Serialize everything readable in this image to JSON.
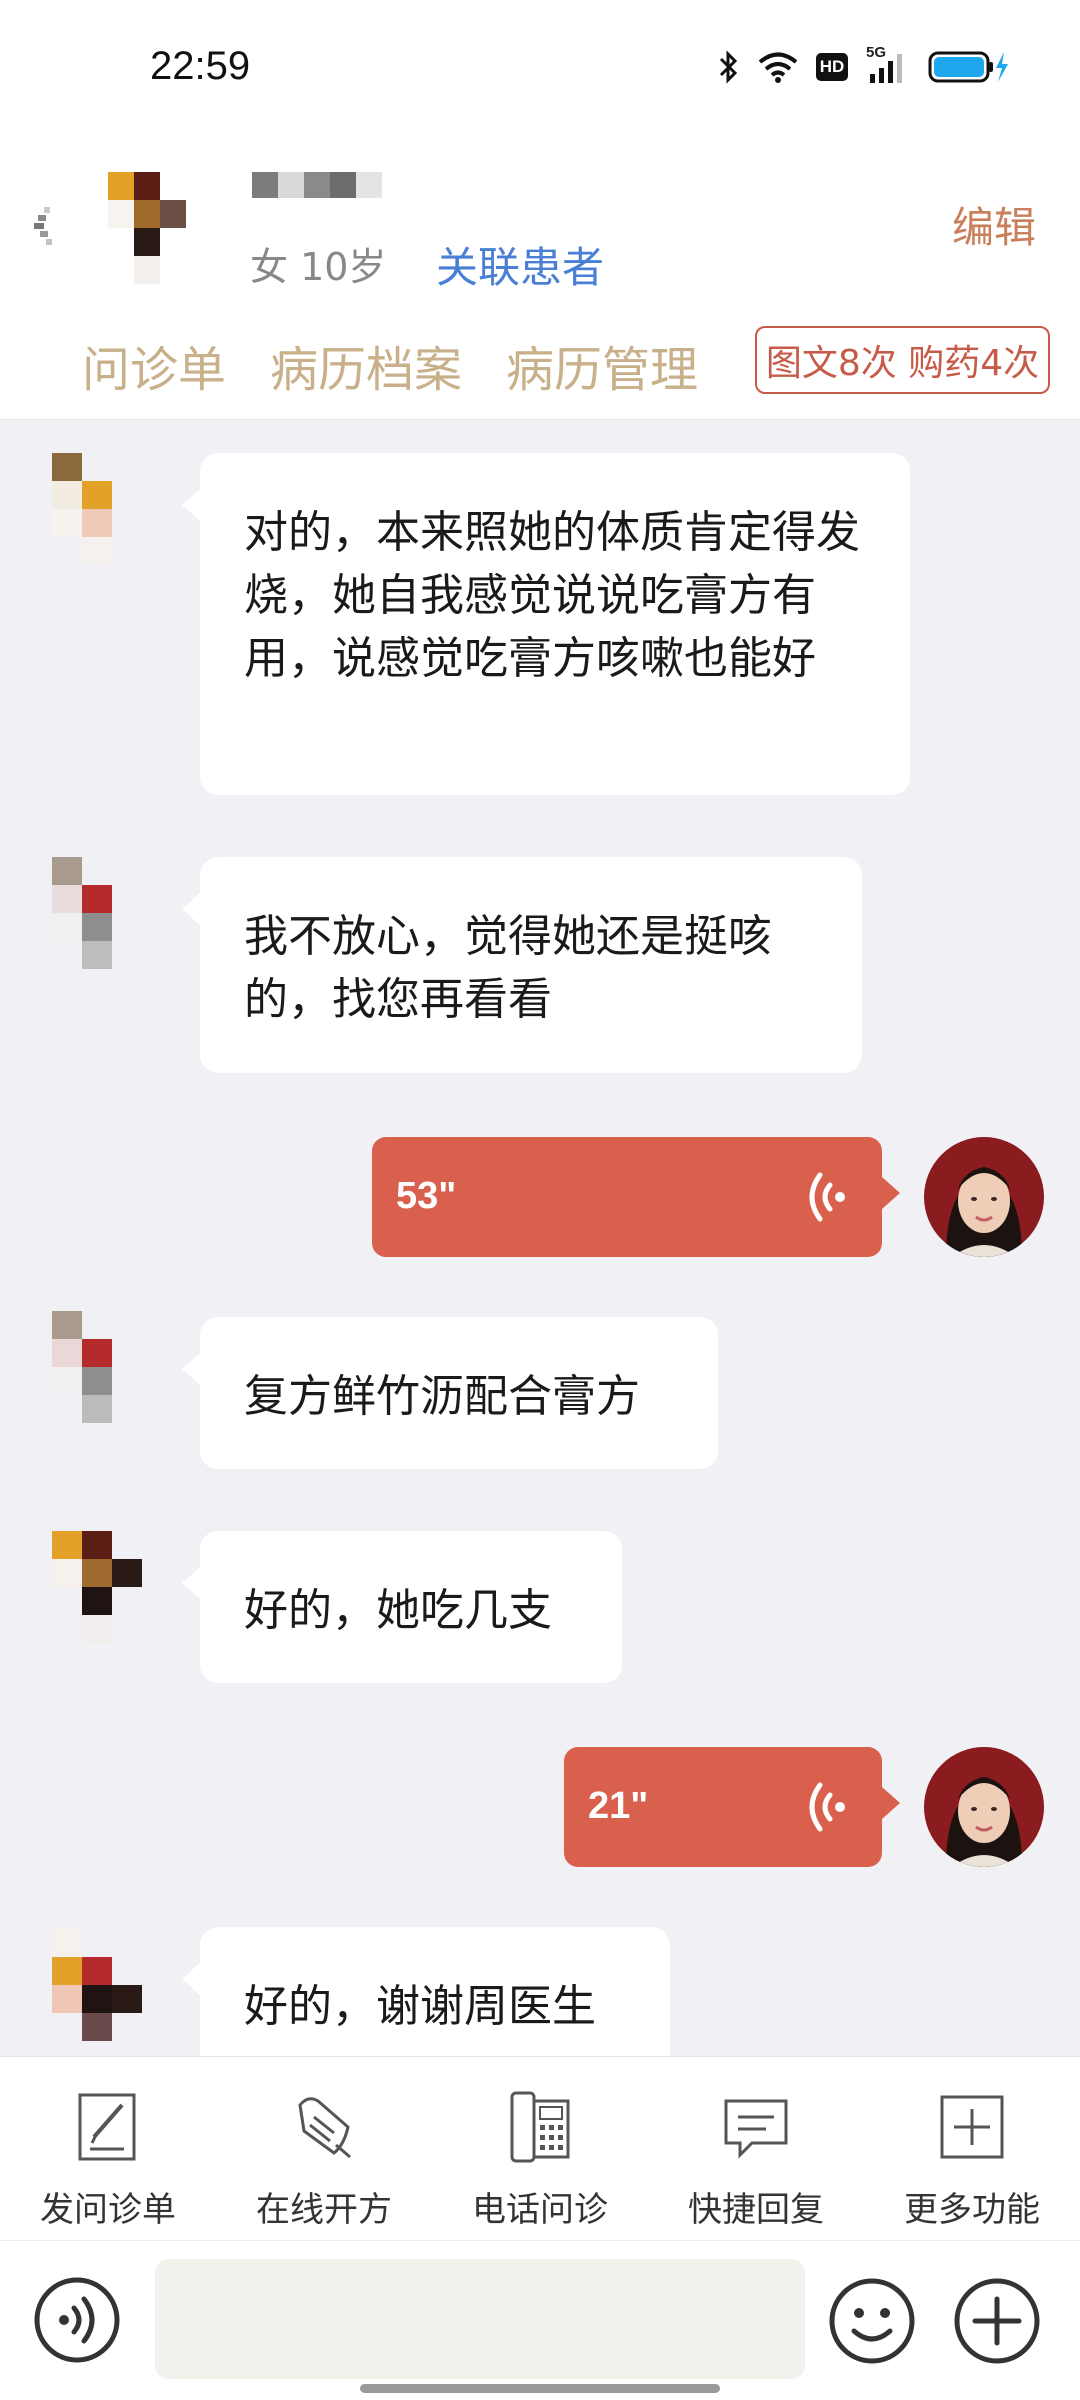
{
  "status_bar": {
    "time": "22:59",
    "hd_label": "HD",
    "network_label": "5G"
  },
  "header": {
    "patient_info": "女 10岁",
    "related_patient_link": "关联患者",
    "edit_link": "编辑",
    "tabs": [
      "问诊单",
      "病历档案",
      "病历管理"
    ],
    "service_badge": "图文8次 购药4次"
  },
  "messages": [
    {
      "sender": "patient",
      "type": "text",
      "text": "对的，本来照她的体质肯定得发烧，她自我感觉说说吃膏方有用，说感觉吃膏方咳嗽也能好"
    },
    {
      "sender": "patient",
      "type": "text",
      "text": "我不放心，觉得她还是挺咳的，找您再看看"
    },
    {
      "sender": "doctor",
      "type": "voice",
      "duration": "53\""
    },
    {
      "sender": "patient",
      "type": "text",
      "text": "复方鲜竹沥配合膏方"
    },
    {
      "sender": "patient",
      "type": "text",
      "text": "好的，她吃几支"
    },
    {
      "sender": "doctor",
      "type": "voice",
      "duration": "21\""
    },
    {
      "sender": "patient",
      "type": "text",
      "text": "好的，谢谢周医生"
    }
  ],
  "toolbar": {
    "items": [
      {
        "label": "发问诊单",
        "icon": "form-edit-icon"
      },
      {
        "label": "在线开方",
        "icon": "prescription-icon"
      },
      {
        "label": "电话问诊",
        "icon": "phone-consult-icon"
      },
      {
        "label": "快捷回复",
        "icon": "quick-reply-icon"
      },
      {
        "label": "更多功能",
        "icon": "more-functions-icon"
      }
    ]
  },
  "input": {
    "placeholder": "",
    "value": ""
  },
  "colors": {
    "accent_tab": "#c8b08a",
    "voice_bubble": "#d9604d",
    "link_blue": "#4a7fd6",
    "edit_orange": "#c87f5a",
    "badge_red": "#c75b4a",
    "chat_background": "#f1f1f5"
  }
}
